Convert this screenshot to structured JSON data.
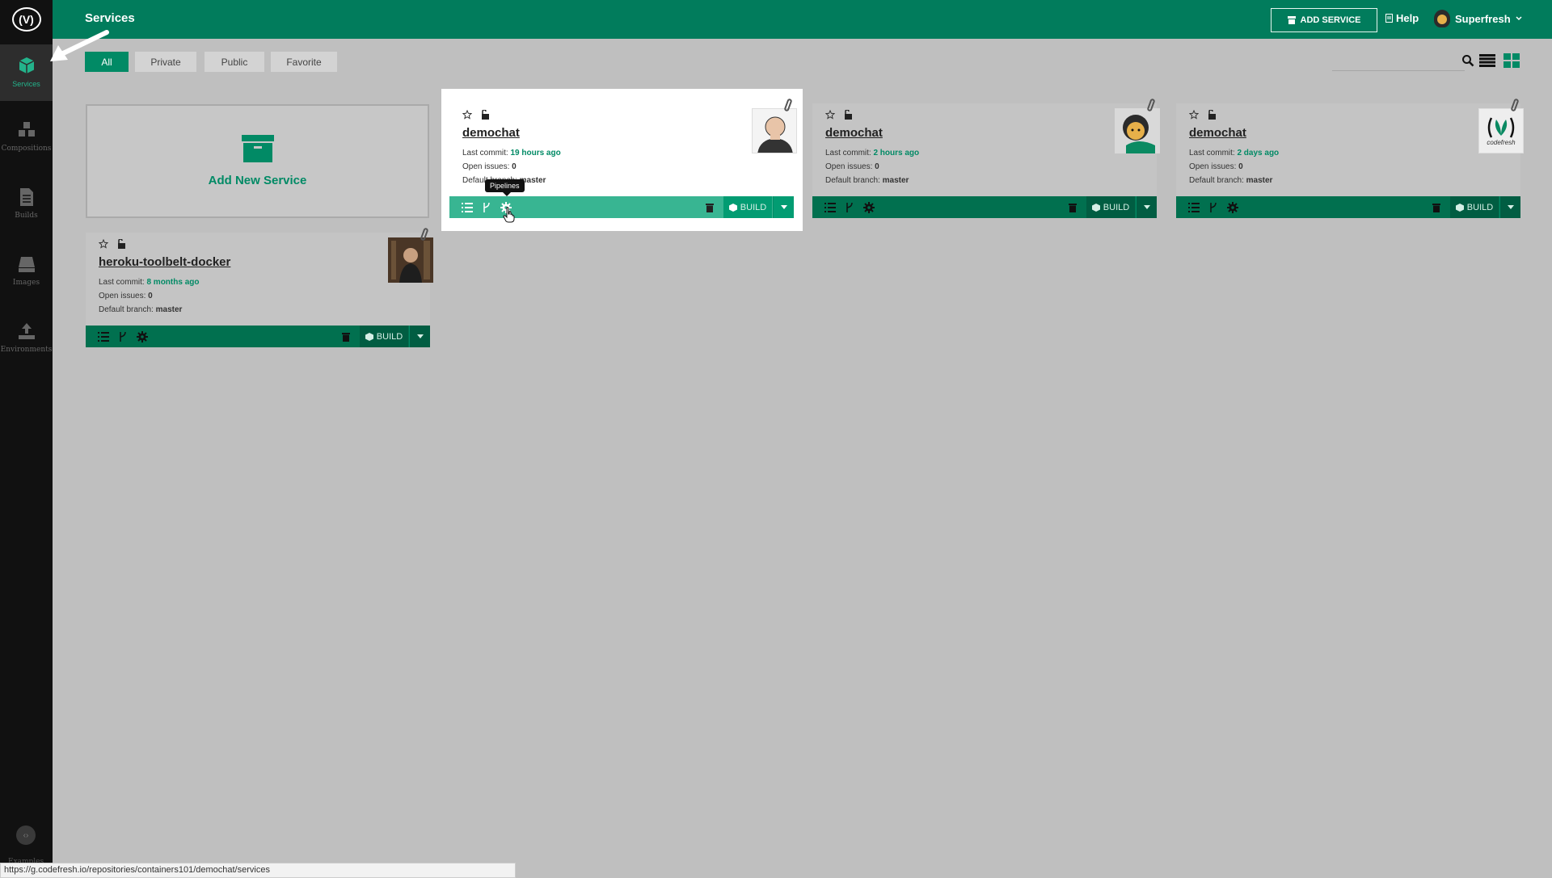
{
  "header": {
    "page_title": "Services",
    "add_service_label": "ADD SERVICE",
    "help_label": "Help",
    "user_name": "Superfresh"
  },
  "sidebar": {
    "logo_text": "(V)",
    "items": [
      {
        "label": "Services",
        "icon": "cube-icon"
      },
      {
        "label": "Compositions",
        "icon": "cubes-icon"
      },
      {
        "label": "Builds",
        "icon": "document-icon"
      },
      {
        "label": "Images",
        "icon": "drive-icon"
      },
      {
        "label": "Environments",
        "icon": "upload-icon"
      }
    ],
    "bottom_label": "Examples"
  },
  "filters": {
    "tabs": [
      "All",
      "Private",
      "Public",
      "Favorite"
    ],
    "active": "All"
  },
  "add_card": {
    "label": "Add New Service"
  },
  "labels": {
    "last_commit": "Last commit:",
    "open_issues": "Open issues:",
    "default_branch": "Default branch:",
    "build": "BUILD"
  },
  "services": [
    {
      "name": "demochat",
      "last_commit": "19 hours ago",
      "open_issues": "0",
      "default_branch": "master",
      "avatar": "man-photo"
    },
    {
      "name": "demochat",
      "last_commit": "2 hours ago",
      "open_issues": "0",
      "default_branch": "master",
      "avatar": "cartoon-avatar"
    },
    {
      "name": "demochat",
      "last_commit": "2 days ago",
      "open_issues": "0",
      "default_branch": "master",
      "avatar": "codefresh-logo",
      "avatar_text": "codefresh"
    },
    {
      "name": "heroku-toolbelt-docker",
      "last_commit": "8 months ago",
      "open_issues": "0",
      "default_branch": "master",
      "avatar": "person-photo"
    }
  ],
  "tooltip": "Pipelines",
  "status_url": "https://g.codefresh.io/repositories/containers101/demochat/services",
  "colors": {
    "brand": "#017c5c",
    "accent": "#018a65",
    "highlight_footer": "#38b592",
    "sidebar_bg": "#111111"
  }
}
